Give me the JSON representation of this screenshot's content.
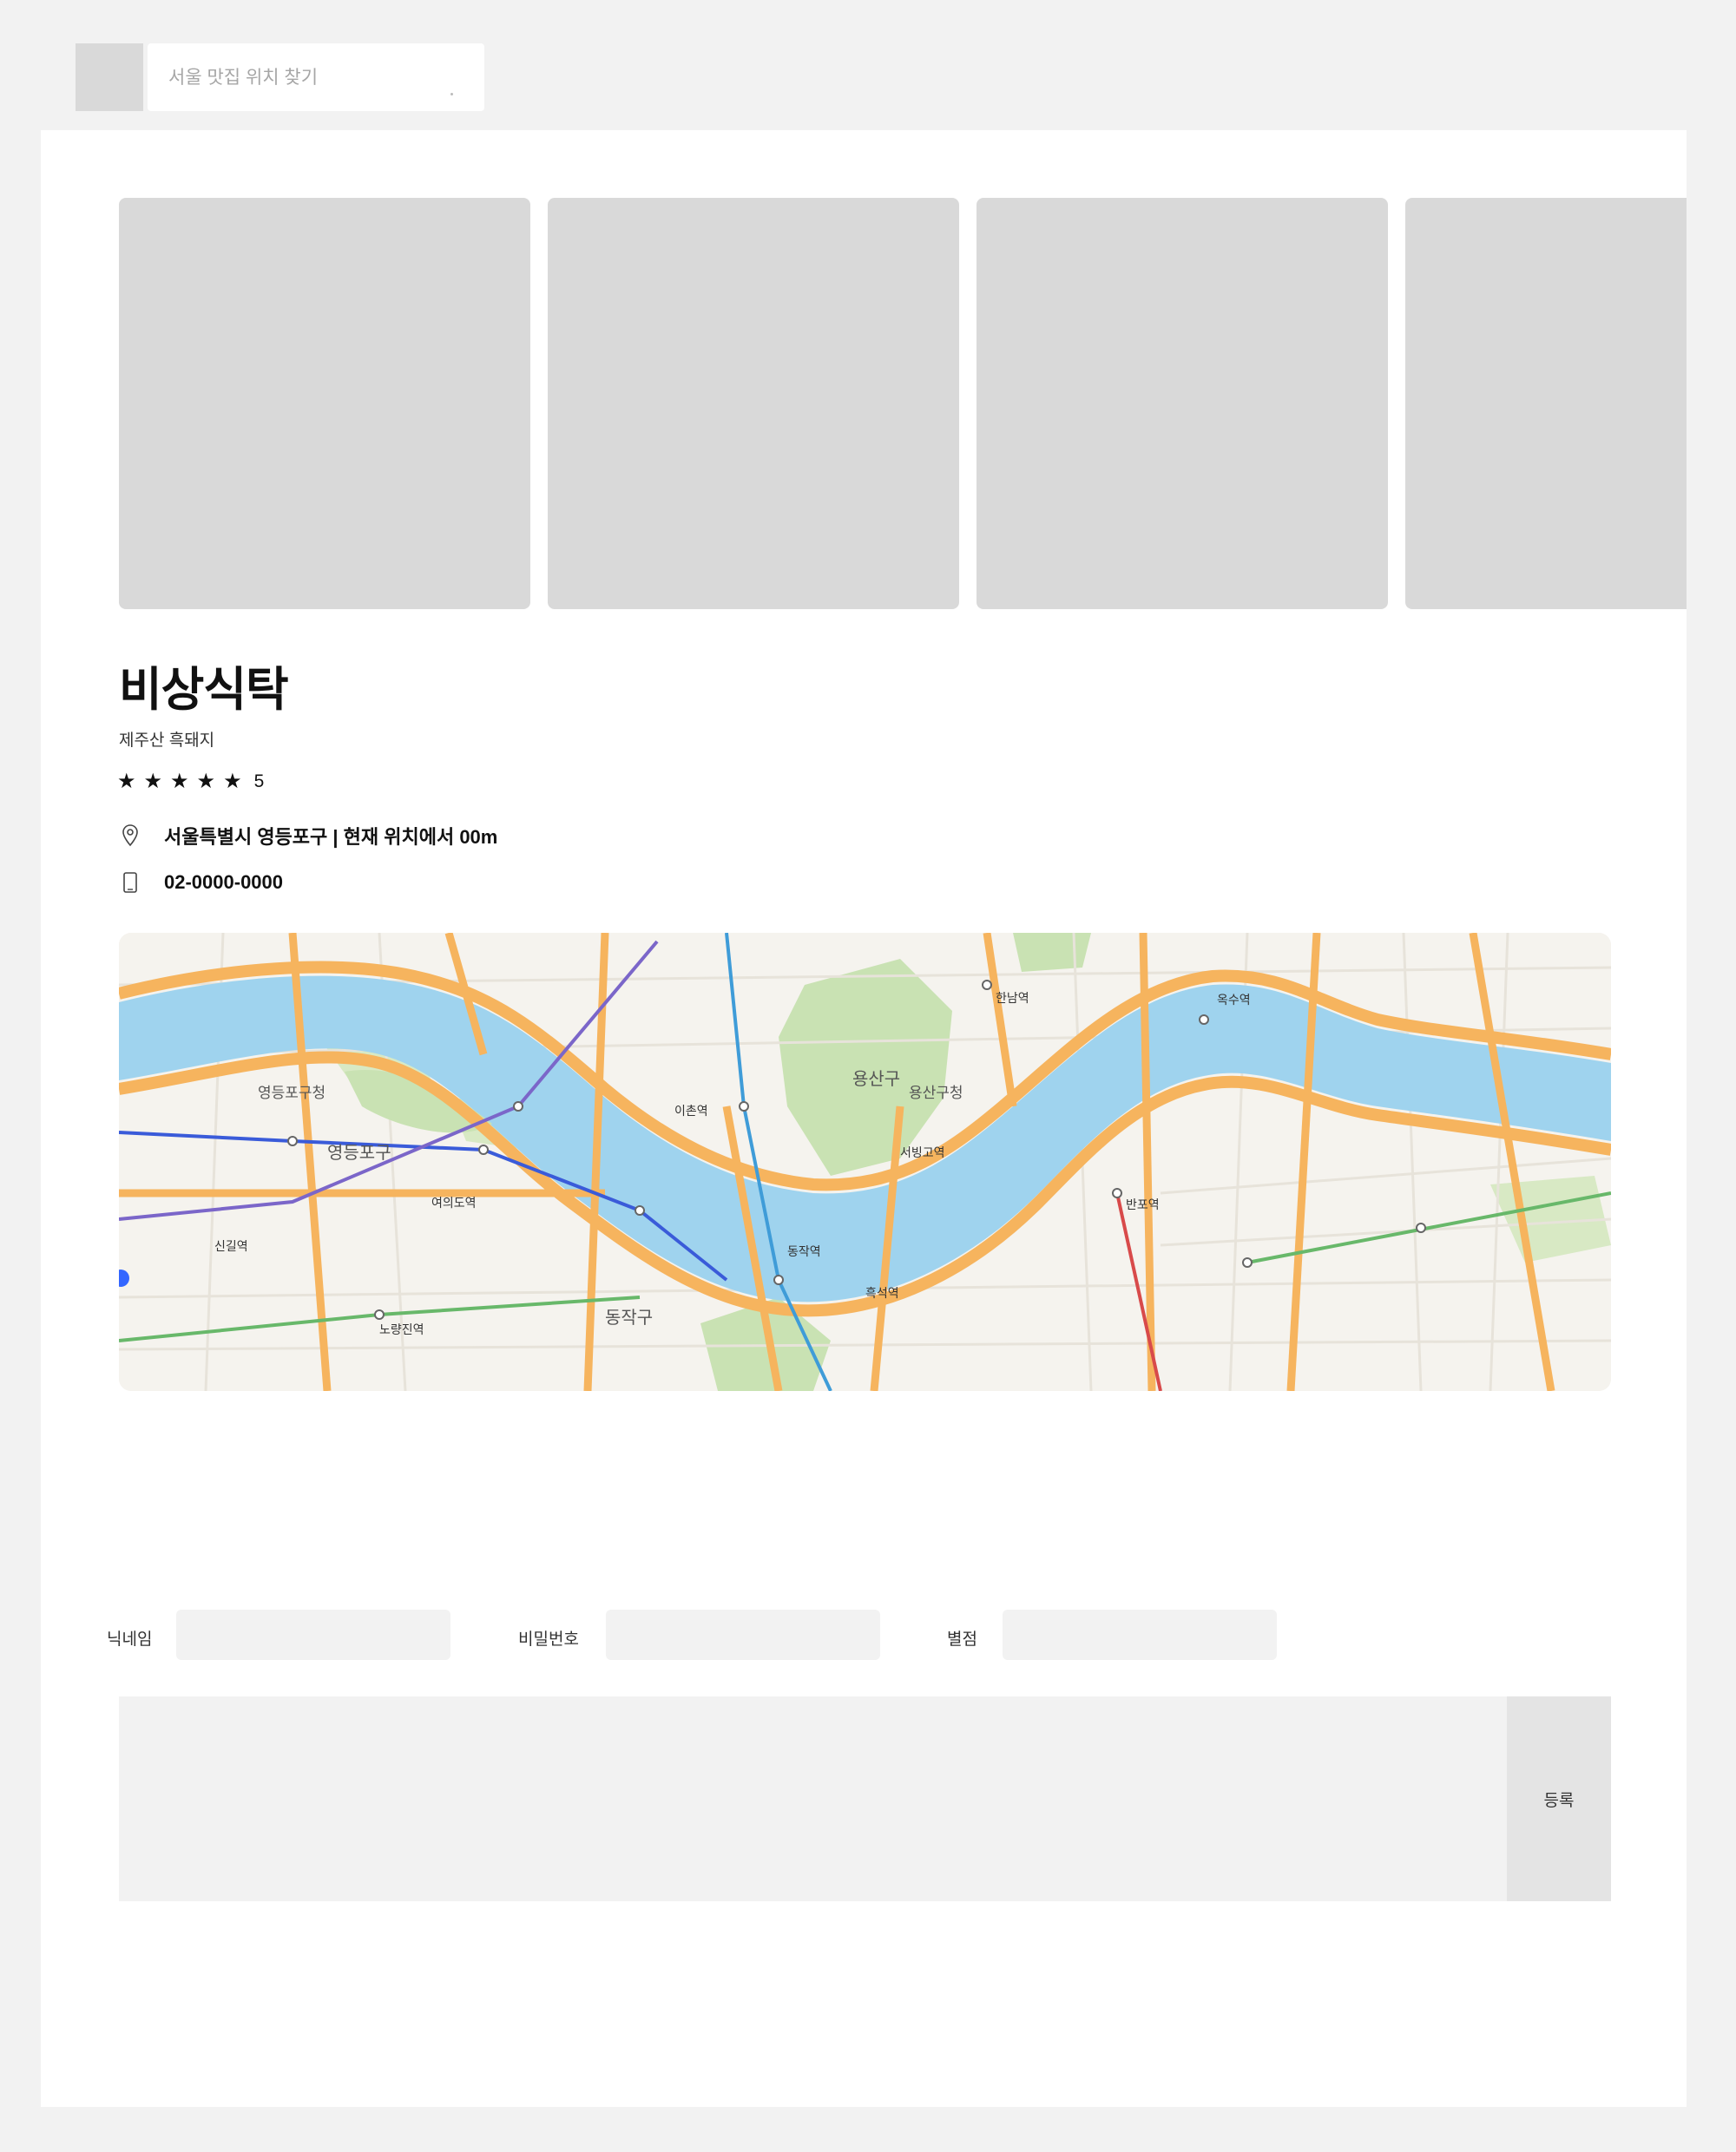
{
  "header": {
    "search": {
      "placeholder": "서울 맛집 위치 찾기"
    }
  },
  "restaurant": {
    "name": "비상식탁",
    "category": "제주산 흑돼지",
    "rating": {
      "stars": 5,
      "value": "5"
    },
    "address": "서울특별시 영등포구 | 현재 위치에서 00m",
    "phone": "02-0000-0000"
  },
  "photos": {
    "count": 4
  },
  "map": {
    "labels": [
      "용산구",
      "용산구청",
      "영등포구청",
      "영등포구",
      "동작구",
      "신길역",
      "여의도역",
      "노량진역",
      "한남역",
      "서빙고역",
      "옥수역",
      "이촌역",
      "흑석역",
      "반포역",
      "동작역"
    ],
    "colors": {
      "water": "#9fd3ee",
      "road": "#f6b45e",
      "park": "#c9e2b3",
      "land": "#f5f3ee"
    }
  },
  "review_form": {
    "nickname_label": "닉네임",
    "password_label": "비밀번호",
    "score_label": "별점",
    "submit_label": "등록"
  }
}
